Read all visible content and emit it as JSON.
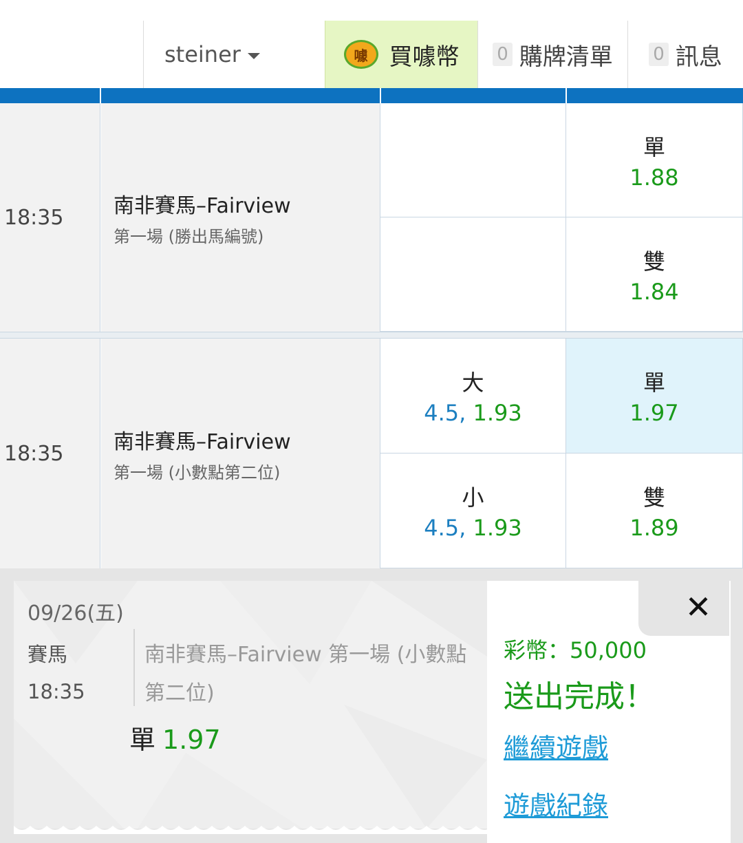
{
  "header": {
    "username": "steiner",
    "buy_label": "買噱幣",
    "coin_glyph": "噱",
    "cart_count": "0",
    "cart_label": "購牌清單",
    "msg_count": "0",
    "msg_label": "訊息"
  },
  "colors": {
    "accent_blue": "#0d72c0",
    "odds_green": "#1a9a1a",
    "line_blue": "#1c7fc0",
    "buy_bg": "#e6f6c4",
    "selected_bg": "#e0f3fb",
    "link_blue": "#1e9bd7"
  },
  "events": [
    {
      "time": "18:35",
      "name": "南非賽馬–Fairview",
      "subtitle": "第一場 (勝出馬編號)",
      "bets": [
        {
          "label": "",
          "odds": ""
        },
        {
          "label": "單",
          "odds": "1.88"
        },
        {
          "label": "",
          "odds": ""
        },
        {
          "label": "雙",
          "odds": "1.84"
        }
      ]
    },
    {
      "time": "18:35",
      "name": "南非賽馬–Fairview",
      "subtitle": "第一場 (小數點第二位)",
      "bets": [
        {
          "label": "大",
          "line": "4.5,",
          "odds": "1.93"
        },
        {
          "label": "單",
          "odds": "1.97",
          "selected": true
        },
        {
          "label": "小",
          "line": "4.5,",
          "odds": "1.93"
        },
        {
          "label": "雙",
          "odds": "1.89"
        }
      ]
    }
  ],
  "receipt": {
    "date": "09/26(五)",
    "category": "賽馬",
    "time": "18:35",
    "game": "南非賽馬–Fairview 第一場 (小數點第二位)",
    "pick_label": "單",
    "pick_odds": "1.97",
    "coins": "彩幣：50,000",
    "status": "送出完成！",
    "continue_link": "繼續遊戲",
    "record_link": "遊戲紀錄",
    "close_icon": "close-icon"
  }
}
